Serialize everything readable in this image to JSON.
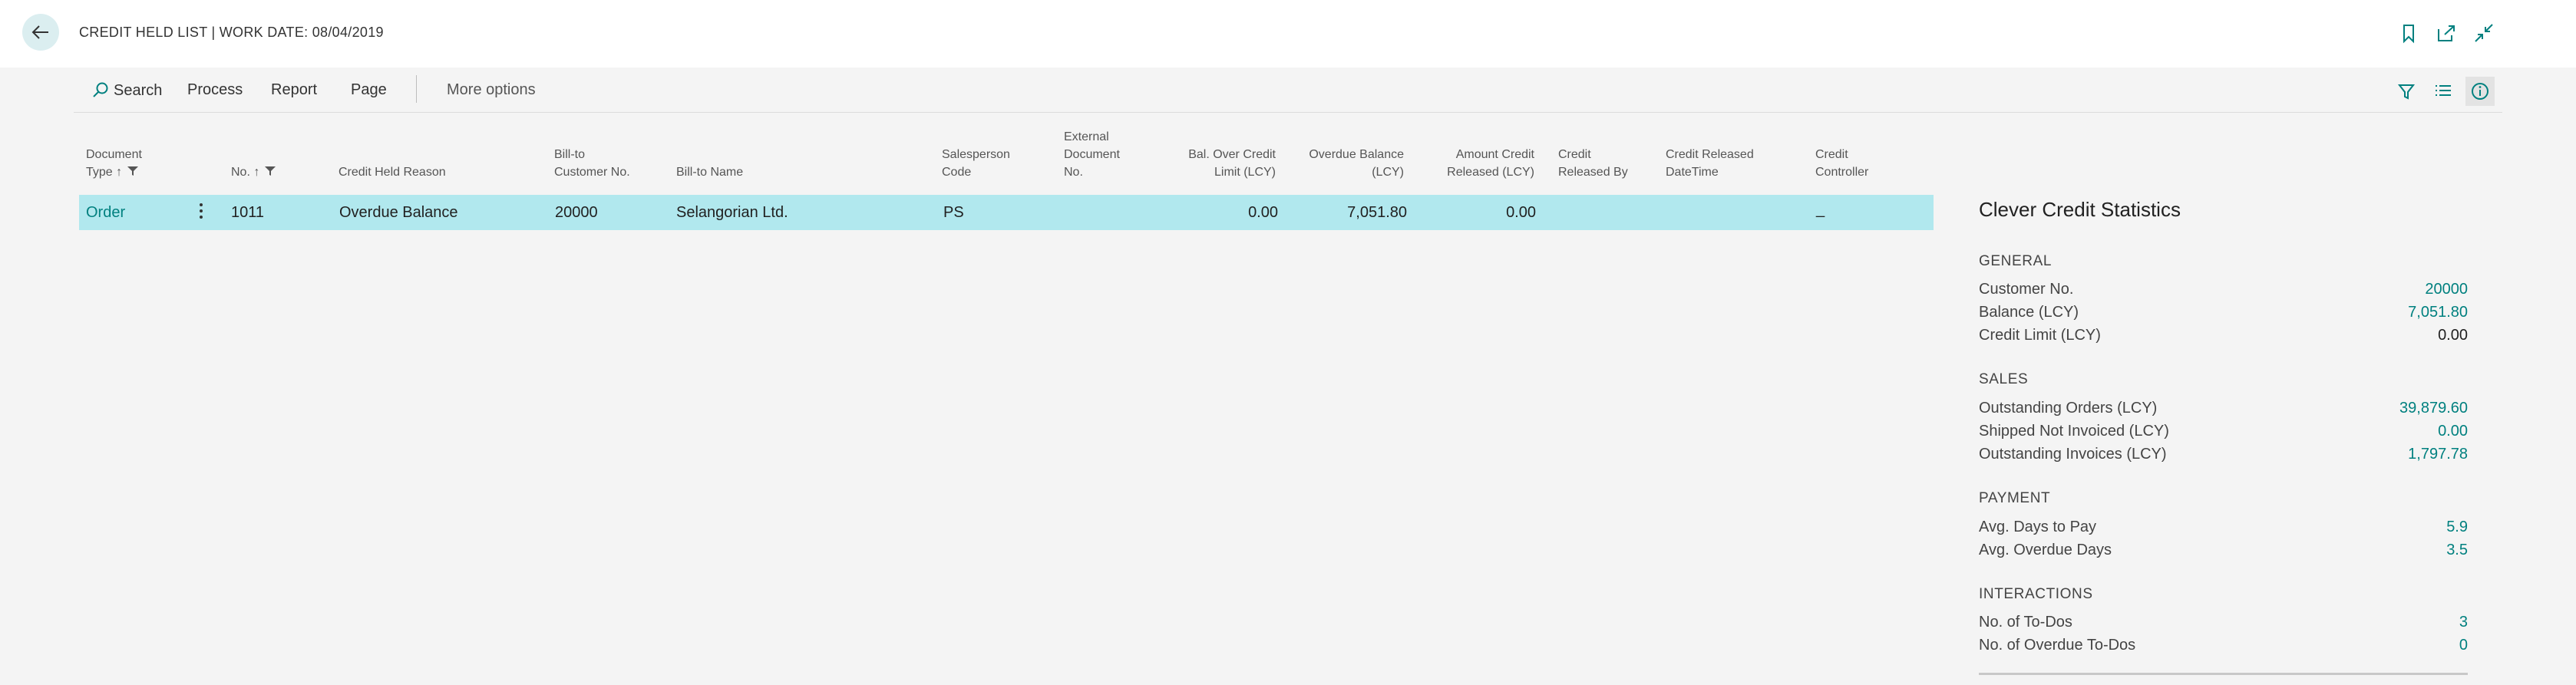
{
  "header": {
    "title": "CREDIT HELD LIST | WORK DATE: 08/04/2019",
    "icons": [
      "back-arrow-icon",
      "bookmark-icon",
      "open-new-window-icon",
      "collapse-icon"
    ]
  },
  "actions": {
    "search": "Search",
    "process": "Process",
    "report": "Report",
    "page": "Page",
    "more": "More options",
    "right_icons": [
      "filter-icon",
      "list-view-icon",
      "info-icon"
    ]
  },
  "columns": [
    {
      "line1": "Document",
      "line2": "Type ↑"
    },
    {
      "line1": "",
      "line2": "No. ↑"
    },
    {
      "line1": "",
      "line2": "Credit Held Reason"
    },
    {
      "line1": "Bill-to",
      "line2": "Customer No."
    },
    {
      "line1": "",
      "line2": "Bill-to Name"
    },
    {
      "line1": "Salesperson",
      "line2": "Code"
    },
    {
      "line0": "External",
      "line1": "Document",
      "line2": "No."
    },
    {
      "line1": "Bal. Over Credit",
      "line2": "Limit (LCY)"
    },
    {
      "line1": "Overdue Balance",
      "line2": "(LCY)"
    },
    {
      "line1": "Amount Credit",
      "line2": "Released (LCY)"
    },
    {
      "line1": "Credit",
      "line2": "Released By"
    },
    {
      "line1": "Credit Released",
      "line2": "DateTime"
    },
    {
      "line1": "Credit",
      "line2": "Controller"
    }
  ],
  "rows": [
    {
      "document_type": "Order",
      "no": "1011",
      "reason": "Overdue Balance",
      "customer_no": "20000",
      "name": "Selangorian Ltd.",
      "salesperson": "PS",
      "external_doc": "",
      "bal_over_limit": "0.00",
      "overdue_balance": "7,051.80",
      "amount_released": "0.00",
      "released_by": "",
      "released_datetime": "",
      "controller": "_"
    }
  ],
  "factbox": {
    "title": "Clever Credit Statistics",
    "sections": [
      {
        "name": "GENERAL",
        "items": [
          {
            "label": "Customer No.",
            "value": "20000"
          },
          {
            "label": "Balance (LCY)",
            "value": "7,051.80"
          },
          {
            "label": "Credit Limit (LCY)",
            "value": "0.00"
          }
        ]
      },
      {
        "name": "SALES",
        "items": [
          {
            "label": "Outstanding Orders (LCY)",
            "value": "39,879.60"
          },
          {
            "label": "Shipped Not Invoiced (LCY)",
            "value": "0.00"
          },
          {
            "label": "Outstanding Invoices (LCY)",
            "value": "1,797.78"
          }
        ]
      },
      {
        "name": "PAYMENT",
        "items": [
          {
            "label": "Avg. Days to Pay",
            "value": "5.9"
          },
          {
            "label": "Avg. Overdue Days",
            "value": "3.5"
          }
        ]
      },
      {
        "name": "INTERACTIONS",
        "items": [
          {
            "label": "No. of To-Dos",
            "value": "3"
          },
          {
            "label": "No. of Overdue To-Dos",
            "value": "0"
          }
        ]
      }
    ]
  },
  "colors": {
    "accent": "#00807f",
    "selected_row": "#b1e8ee",
    "back_button_bg": "#dbeef0"
  }
}
